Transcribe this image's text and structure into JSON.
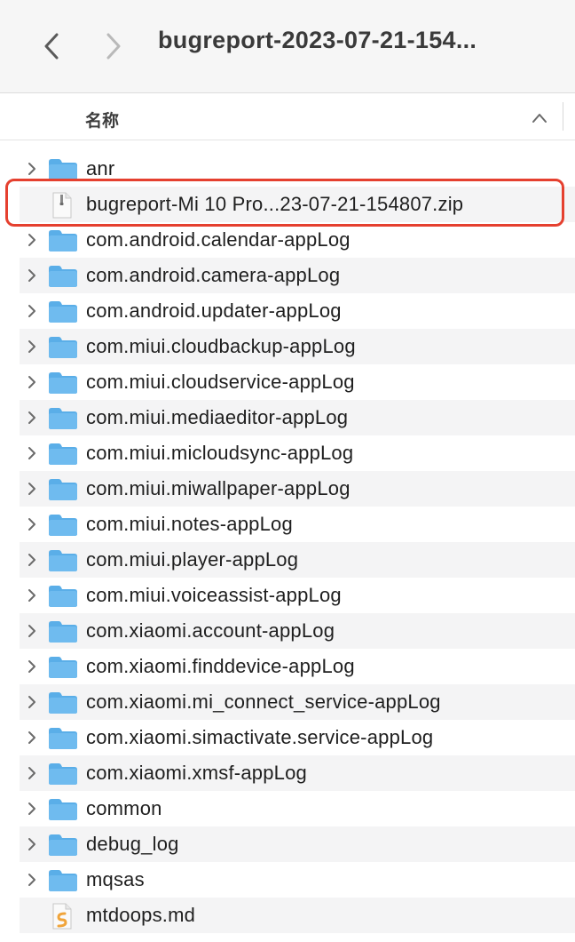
{
  "toolbar": {
    "title": "bugreport-2023-07-21-154...",
    "back_icon": "chevron-left-icon",
    "forward_icon": "chevron-right-icon"
  },
  "column_header": {
    "name_label": "名称",
    "sort_icon": "chevron-up-icon"
  },
  "colors": {
    "highlight": "#e5402f",
    "folder": "#5aaee8",
    "folder_tab": "#6fbbef"
  },
  "files": [
    {
      "name": "anr",
      "kind": "folder",
      "icon": "folder-icon",
      "expandable": true
    },
    {
      "name": "bugreport-Mi 10 Pro...23-07-21-154807.zip",
      "kind": "zip",
      "icon": "zip-file-icon",
      "expandable": false,
      "highlighted": true
    },
    {
      "name": "com.android.calendar-appLog",
      "kind": "folder",
      "icon": "folder-icon",
      "expandable": true
    },
    {
      "name": "com.android.camera-appLog",
      "kind": "folder",
      "icon": "folder-icon",
      "expandable": true
    },
    {
      "name": "com.android.updater-appLog",
      "kind": "folder",
      "icon": "folder-icon",
      "expandable": true
    },
    {
      "name": "com.miui.cloudbackup-appLog",
      "kind": "folder",
      "icon": "folder-icon",
      "expandable": true
    },
    {
      "name": "com.miui.cloudservice-appLog",
      "kind": "folder",
      "icon": "folder-icon",
      "expandable": true
    },
    {
      "name": "com.miui.mediaeditor-appLog",
      "kind": "folder",
      "icon": "folder-icon",
      "expandable": true
    },
    {
      "name": "com.miui.micloudsync-appLog",
      "kind": "folder",
      "icon": "folder-icon",
      "expandable": true
    },
    {
      "name": "com.miui.miwallpaper-appLog",
      "kind": "folder",
      "icon": "folder-icon",
      "expandable": true
    },
    {
      "name": "com.miui.notes-appLog",
      "kind": "folder",
      "icon": "folder-icon",
      "expandable": true
    },
    {
      "name": "com.miui.player-appLog",
      "kind": "folder",
      "icon": "folder-icon",
      "expandable": true
    },
    {
      "name": "com.miui.voiceassist-appLog",
      "kind": "folder",
      "icon": "folder-icon",
      "expandable": true
    },
    {
      "name": "com.xiaomi.account-appLog",
      "kind": "folder",
      "icon": "folder-icon",
      "expandable": true
    },
    {
      "name": "com.xiaomi.finddevice-appLog",
      "kind": "folder",
      "icon": "folder-icon",
      "expandable": true
    },
    {
      "name": "com.xiaomi.mi_connect_service-appLog",
      "kind": "folder",
      "icon": "folder-icon",
      "expandable": true
    },
    {
      "name": "com.xiaomi.simactivate.service-appLog",
      "kind": "folder",
      "icon": "folder-icon",
      "expandable": true
    },
    {
      "name": "com.xiaomi.xmsf-appLog",
      "kind": "folder",
      "icon": "folder-icon",
      "expandable": true
    },
    {
      "name": "common",
      "kind": "folder",
      "icon": "folder-icon",
      "expandable": true
    },
    {
      "name": "debug_log",
      "kind": "folder",
      "icon": "folder-icon",
      "expandable": true
    },
    {
      "name": "mqsas",
      "kind": "folder",
      "icon": "folder-icon",
      "expandable": true
    },
    {
      "name": "mtdoops.md",
      "kind": "markdown",
      "icon": "markdown-file-icon",
      "expandable": false
    }
  ]
}
